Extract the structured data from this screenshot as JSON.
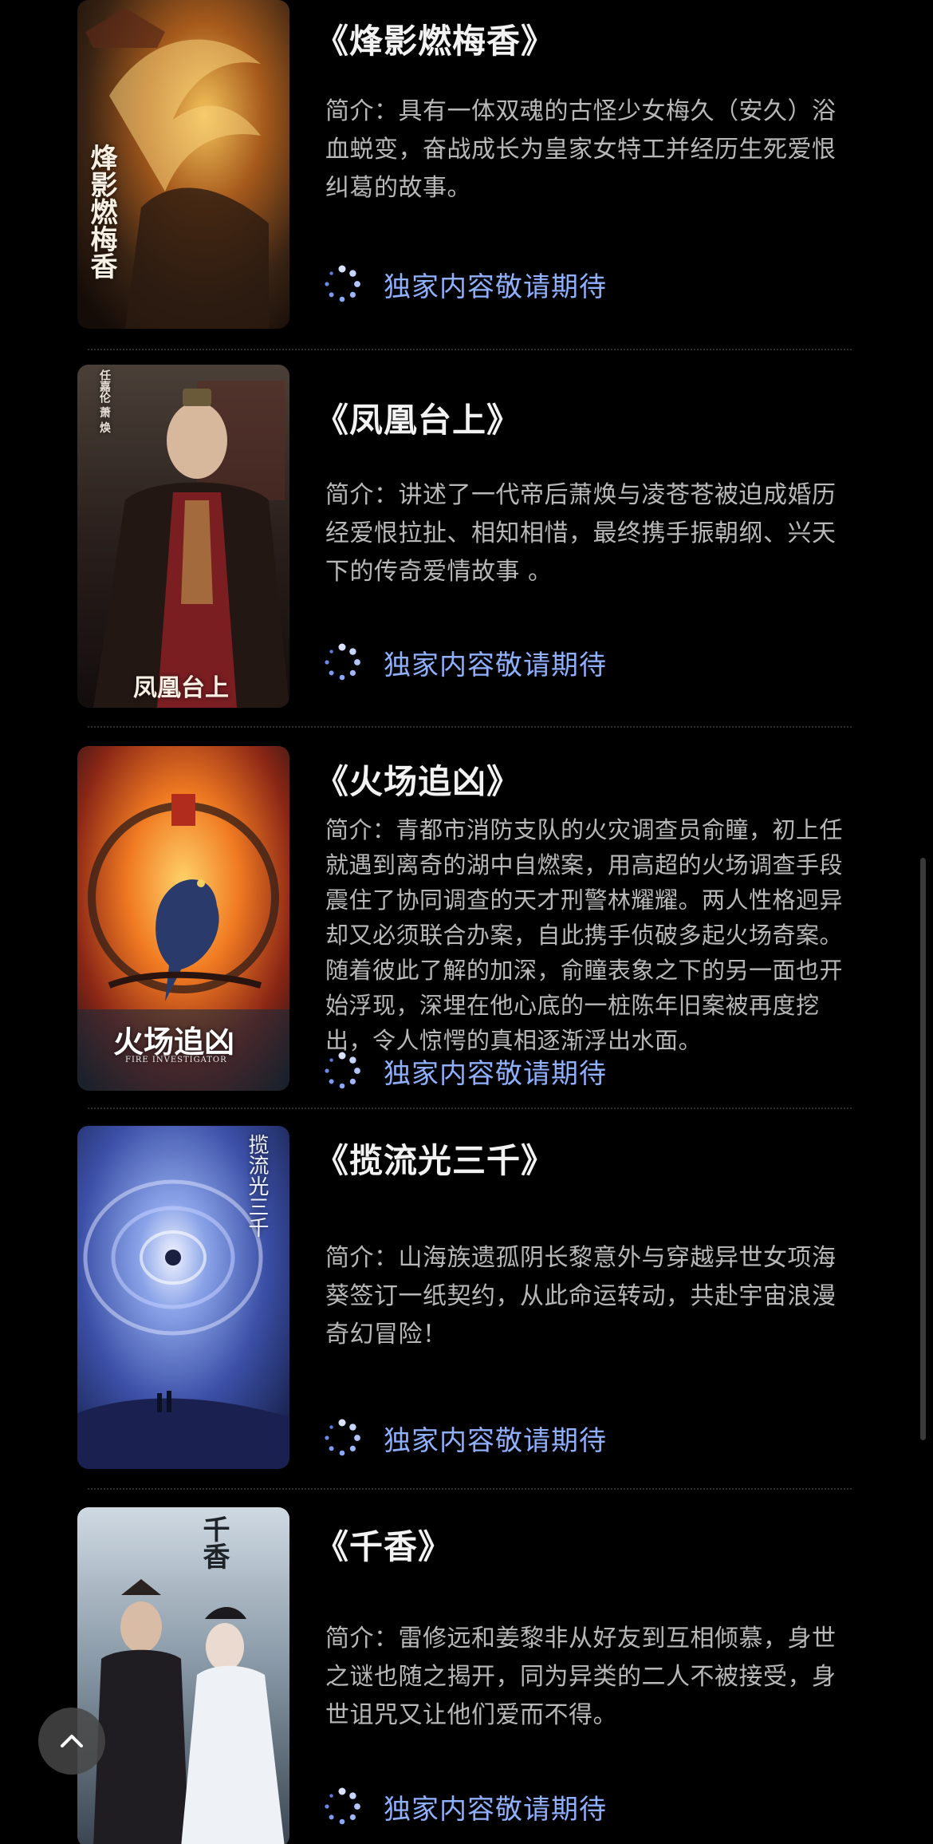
{
  "items": [
    {
      "title": "《烽影燃梅香》",
      "poster_text": "烽影燃梅香",
      "description": "简介：具有一体双魂的古怪少女梅久（安久）浴血蜕变，奋战成长为皇家女特工并经历生死爱恨纠葛的故事。",
      "exclusive_label": "独家内容敬请期待"
    },
    {
      "title": "《凤凰台上》",
      "poster_text": "凤凰台上",
      "poster_credit": "任嘉伦 萧 焕",
      "description": "简介：讲述了一代帝后萧焕与凌苍苍被迫成婚历经爱恨拉扯、相知相惜，最终携手振朝纲、兴天下的传奇爱情故事 。",
      "exclusive_label": "独家内容敬请期待"
    },
    {
      "title": "《火场追凶》",
      "poster_text": "火场追凶",
      "poster_subtext": "FIRE INVESTIGATOR",
      "description": "简介：青都市消防支队的火灾调查员俞瞳，初上任就遇到离奇的湖中自燃案，用高超的火场调查手段震住了协同调查的天才刑警林耀耀。两人性格迥异却又必须联合办案，自此携手侦破多起火场奇案。随着彼此了解的加深，俞瞳表象之下的另一面也开始浮现，深埋在他心底的一桩陈年旧案被再度挖出，令人惊愕的真相逐渐浮出水面。",
      "exclusive_label": "独家内容敬请期待"
    },
    {
      "title": "《揽流光三千》",
      "poster_text": "揽流光三千",
      "description": "简介：山海族遗孤阴长黎意外与穿越异世女项海葵签订一纸契约，从此命运转动，共赴宇宙浪漫奇幻冒险！",
      "exclusive_label": "独家内容敬请期待"
    },
    {
      "title": "《千香》",
      "poster_text": "千香",
      "description": "简介：雷修远和姜黎非从好友到互相倾慕，身世之谜也随之揭开，同为异类的二人不被接受，身世诅咒又让他们爱而不得。",
      "exclusive_label": "独家内容敬请期待"
    }
  ],
  "colors": {
    "background": "#000000",
    "title": "#f2f2f2",
    "description": "#b8b8b8",
    "accent": "#8fb0ff"
  },
  "icons": {
    "loading": "loading-dots-icon",
    "back_to_top": "chevron-up-icon"
  }
}
